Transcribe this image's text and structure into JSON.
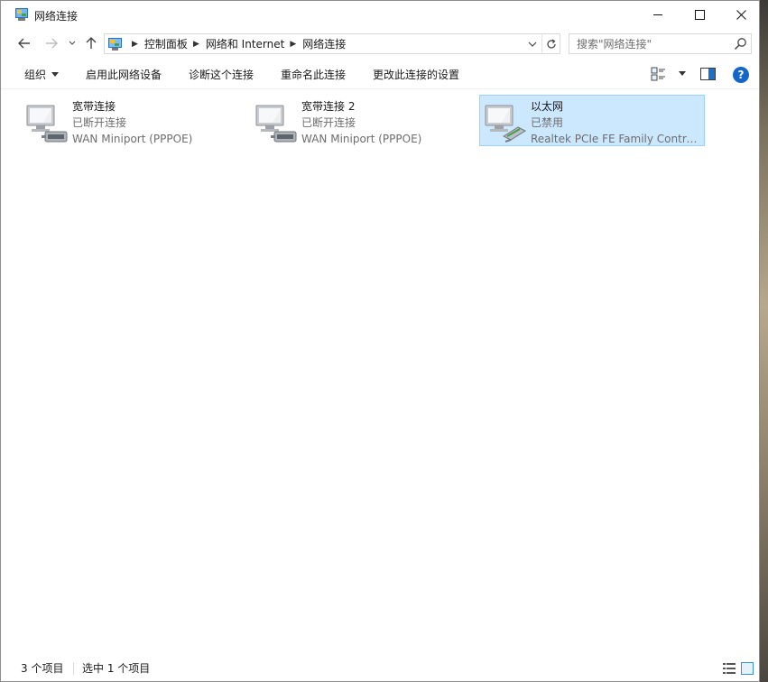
{
  "window": {
    "title": "网络连接"
  },
  "nav": {
    "breadcrumbs": [
      "控制面板",
      "网络和 Internet",
      "网络连接"
    ],
    "search_placeholder": "搜索\"网络连接\""
  },
  "toolbar": {
    "organize": "组织",
    "enable_device": "启用此网络设备",
    "diagnose": "诊断这个连接",
    "rename": "重命名此连接",
    "change_settings": "更改此连接的设置",
    "help_glyph": "?"
  },
  "connections": [
    {
      "name": "宽带连接",
      "status": "已断开连接",
      "device": "WAN Miniport (PPPOE)",
      "selected": false
    },
    {
      "name": "宽带连接 2",
      "status": "已断开连接",
      "device": "WAN Miniport (PPPOE)",
      "selected": false
    },
    {
      "name": "以太网",
      "status": "已禁用",
      "device": "Realtek PCIe FE Family Controller",
      "selected": true
    }
  ],
  "statusbar": {
    "item_count": "3 个项目",
    "selected_count": "选中 1 个项目"
  },
  "colors": {
    "selection_bg": "#cce8ff",
    "selection_border": "#99d1ff",
    "help_blue": "#1466c8"
  },
  "icons": {
    "app": "network-connections-icon",
    "control_panel": "control-panel-icon",
    "connection": "network-adapter-icon"
  }
}
